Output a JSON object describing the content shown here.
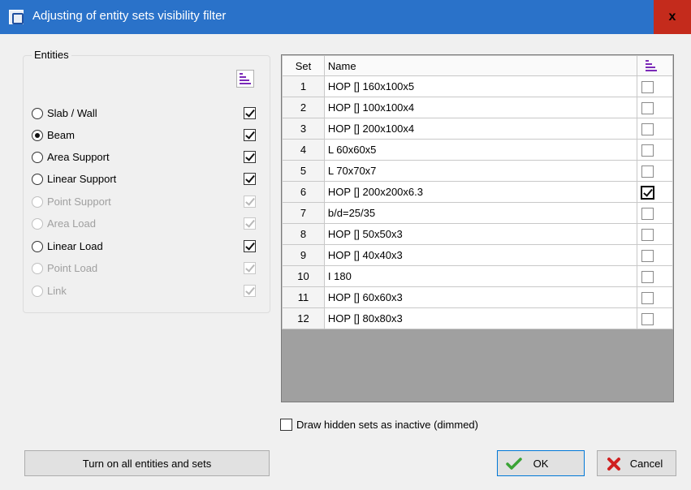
{
  "window": {
    "title": "Adjusting of entity sets visibility filter",
    "close_label": "x"
  },
  "entities": {
    "group_title": "Entities",
    "items": [
      {
        "label": "Slab / Wall",
        "selected": false,
        "enabled": true,
        "checked": true
      },
      {
        "label": "Beam",
        "selected": true,
        "enabled": true,
        "checked": true
      },
      {
        "label": "Area Support",
        "selected": false,
        "enabled": true,
        "checked": true
      },
      {
        "label": "Linear Support",
        "selected": false,
        "enabled": true,
        "checked": true
      },
      {
        "label": "Point Support",
        "selected": false,
        "enabled": false,
        "checked": true
      },
      {
        "label": "Area Load",
        "selected": false,
        "enabled": false,
        "checked": true
      },
      {
        "label": "Linear Load",
        "selected": false,
        "enabled": true,
        "checked": true
      },
      {
        "label": "Point Load",
        "selected": false,
        "enabled": false,
        "checked": true
      },
      {
        "label": "Link",
        "selected": false,
        "enabled": false,
        "checked": true
      }
    ]
  },
  "sets_table": {
    "headers": {
      "set": "Set",
      "name": "Name"
    },
    "rows": [
      {
        "set": "1",
        "name": "НОР [] 160x100x5",
        "checked": false
      },
      {
        "set": "2",
        "name": "НОР [] 100x100x4",
        "checked": false
      },
      {
        "set": "3",
        "name": "НОР [] 200x100x4",
        "checked": false
      },
      {
        "set": "4",
        "name": "L 60x60x5",
        "checked": false
      },
      {
        "set": "5",
        "name": "L 70x70x7",
        "checked": false
      },
      {
        "set": "6",
        "name": "НОР [] 200x200x6.3",
        "checked": true
      },
      {
        "set": "7",
        "name": "b/d=25/35",
        "checked": false
      },
      {
        "set": "8",
        "name": "НОР [] 50x50x3",
        "checked": false
      },
      {
        "set": "9",
        "name": "НОР [] 40x40x3",
        "checked": false
      },
      {
        "set": "10",
        "name": "I 180",
        "checked": false
      },
      {
        "set": "11",
        "name": "НОР [] 60x60x3",
        "checked": false
      },
      {
        "set": "12",
        "name": "НОР [] 80x80x3",
        "checked": false
      }
    ]
  },
  "options": {
    "draw_hidden_label": "Draw hidden sets as inactive (dimmed)",
    "draw_hidden_checked": false
  },
  "buttons": {
    "turn_on_all": "Turn on all entities and sets",
    "ok": "OK",
    "cancel": "Cancel"
  },
  "colors": {
    "titlebar": "#2a72c9",
    "close": "#c42b1c",
    "sort_icon": "#7b2ab8",
    "grid_bg": "#a0a0a0"
  }
}
